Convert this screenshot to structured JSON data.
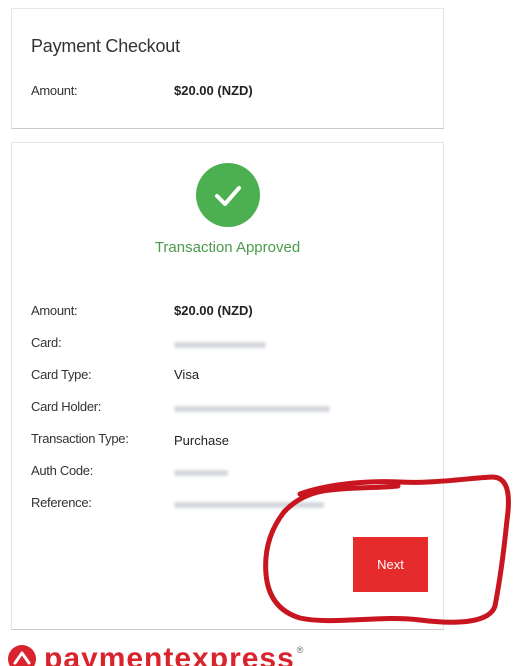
{
  "checkout": {
    "title": "Payment Checkout",
    "amount_label": "Amount:",
    "amount_value": "$20.00 (NZD)"
  },
  "result": {
    "status": "Transaction Approved",
    "rows": [
      {
        "label": "Amount:",
        "value": "$20.00 (NZD)"
      },
      {
        "label": "Card:",
        "value": ""
      },
      {
        "label": "Card Type:",
        "value": "Visa"
      },
      {
        "label": "Card Holder:",
        "value": ""
      },
      {
        "label": "Transaction Type:",
        "value": "Purchase"
      },
      {
        "label": "Auth Code:",
        "value": ""
      },
      {
        "label": "Reference:",
        "value": ""
      }
    ],
    "next_label": "Next"
  },
  "brand": {
    "logo_text": "paymentexpress",
    "reg_mark": "®"
  },
  "colors": {
    "approved_green": "#4caf50",
    "button_red": "#e52b2b",
    "annotation_red": "#c8151f",
    "brand_red": "#d9232d"
  },
  "icons": {
    "status": "checkmark-icon",
    "annotation": "hand-drawn-circle"
  }
}
